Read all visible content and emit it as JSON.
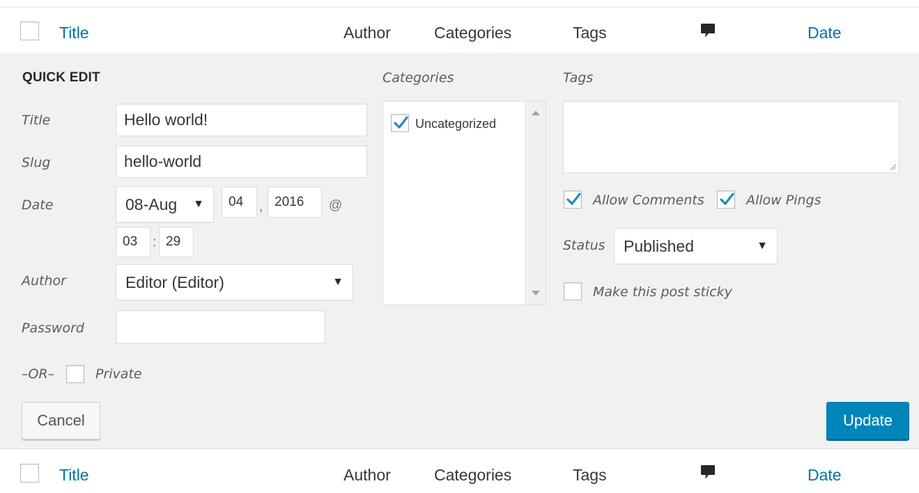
{
  "colors": {
    "link": "#0073aa",
    "primary_button": "#0085ba",
    "panel_bg": "#f1f1f1",
    "check": "#1e8cbe"
  },
  "header": {
    "title": "Title",
    "author": "Author",
    "categories": "Categories",
    "tags": "Tags",
    "comments_icon": "comment-bubble-icon",
    "date": "Date"
  },
  "footer": {
    "title": "Title",
    "author": "Author",
    "categories": "Categories",
    "tags": "Tags",
    "comments_icon": "comment-bubble-icon",
    "date": "Date"
  },
  "quick_edit": {
    "heading": "QUICK EDIT",
    "title_label": "Title",
    "title_value": "Hello world!",
    "slug_label": "Slug",
    "slug_value": "hello-world",
    "date_label": "Date",
    "month_value": "08-Aug",
    "day_value": "04",
    "comma": ",",
    "year_value": "2016",
    "at": "@",
    "hour_value": "03",
    "colon": ":",
    "minute_value": "29",
    "author_label": "Author",
    "author_value": "Editor (Editor)",
    "password_label": "Password",
    "password_value": "",
    "or_label": "–OR–",
    "private_label": "Private",
    "private_checked": false,
    "categories_label": "Categories",
    "categories": [
      {
        "label": "Uncategorized",
        "checked": true
      }
    ],
    "tags_label": "Tags",
    "tags_value": "",
    "allow_comments_label": "Allow Comments",
    "allow_comments_checked": true,
    "allow_pings_label": "Allow Pings",
    "allow_pings_checked": true,
    "status_label": "Status",
    "status_value": "Published",
    "sticky_label": "Make this post sticky",
    "sticky_checked": false,
    "cancel_label": "Cancel",
    "update_label": "Update"
  }
}
